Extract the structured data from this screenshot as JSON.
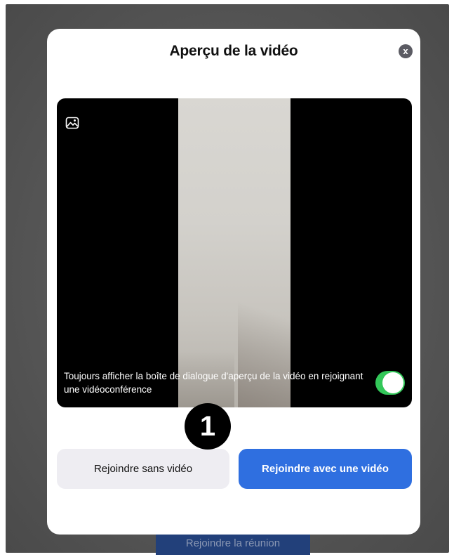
{
  "background": {
    "join_meeting_label": "Rejoindre la réunion"
  },
  "dialog": {
    "title": "Aperçu de la vidéo",
    "close_label": "x",
    "preview": {
      "image_icon": "image-icon",
      "always_show_label": "Toujours afficher la boîte de dialogue d'aperçu de la vidéo en rejoignant une vidéoconférence",
      "always_show_enabled": true
    },
    "step_marker": "1",
    "buttons": {
      "join_without_video": "Rejoindre sans vidéo",
      "join_with_video": "Rejoindre avec une vidéo"
    }
  },
  "colors": {
    "toggle_on": "#33c759",
    "primary_button": "#2f6fe0",
    "secondary_button": "#eeedf2"
  }
}
